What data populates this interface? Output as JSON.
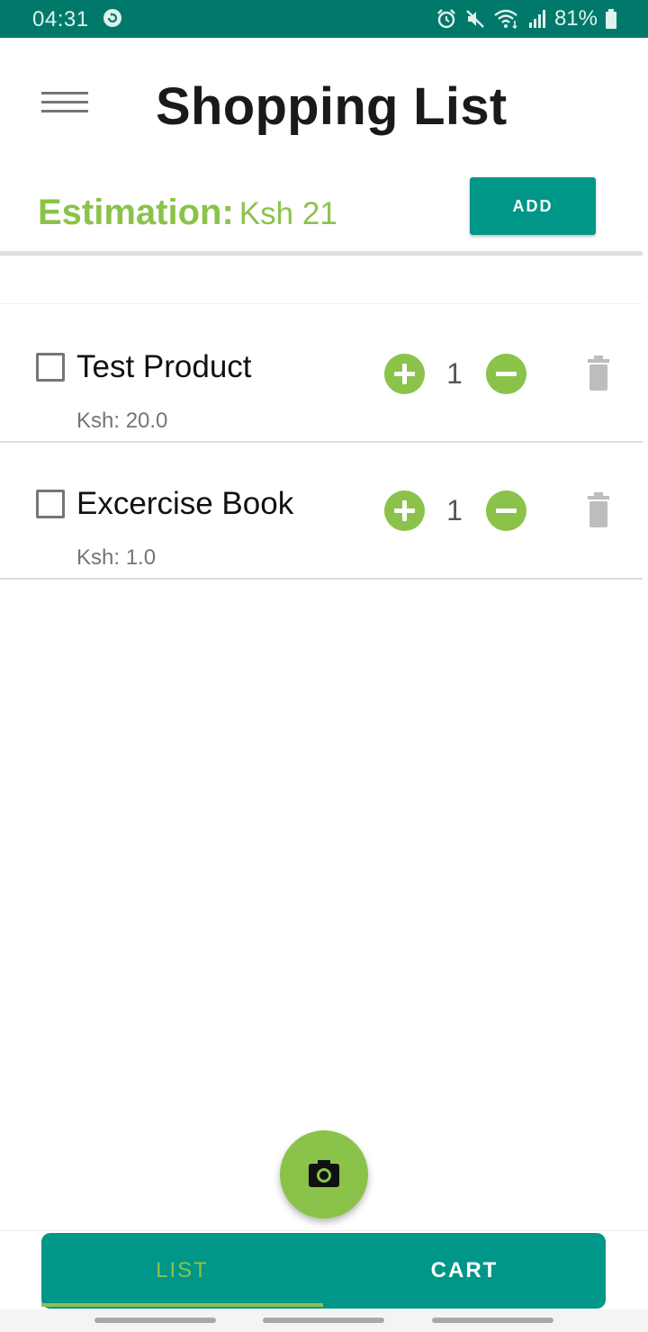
{
  "status_bar": {
    "time": "04:31",
    "battery": "81%"
  },
  "header": {
    "title": "Shopping List",
    "menu_icon": "hamburger-menu-icon"
  },
  "estimation": {
    "label": "Estimation:",
    "value": "Ksh 21"
  },
  "toolbar": {
    "add_label": "ADD"
  },
  "items": [
    {
      "name": "Test Product",
      "price": "Ksh: 20.0",
      "quantity": "1",
      "checked": false
    },
    {
      "name": "Excercise Book",
      "price": "Ksh: 1.0",
      "quantity": "1",
      "checked": false
    }
  ],
  "fab": {
    "icon": "camera-icon"
  },
  "bottom_nav": {
    "tabs": [
      {
        "label": "LIST",
        "active": true
      },
      {
        "label": "CART",
        "active": false
      }
    ]
  },
  "colors": {
    "status_bar": "#00796b",
    "primary": "#009688",
    "accent": "#8bc34a",
    "text": "#1a1a1a",
    "muted": "#757575",
    "icon_gray": "#bdbdbd"
  }
}
